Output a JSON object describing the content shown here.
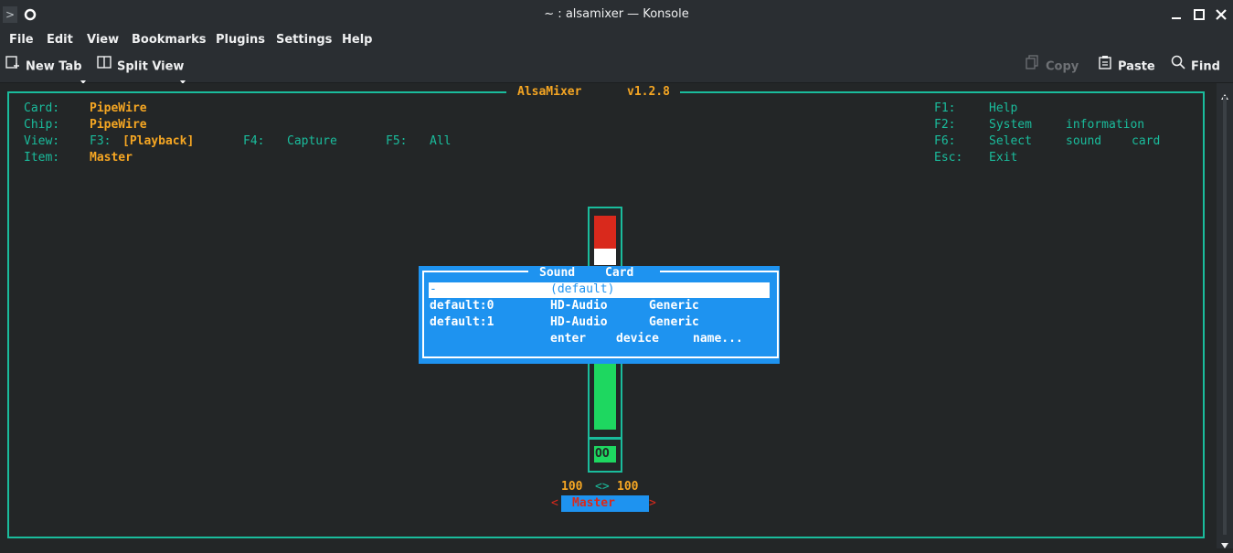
{
  "window": {
    "title": "~ : alsamixer — Konsole",
    "minimize_icon": "minimize-icon",
    "maximize_icon": "maximize-icon",
    "close_icon": "close-icon"
  },
  "menubar": {
    "items": [
      "File",
      "Edit",
      "View",
      "Bookmarks",
      "Plugins",
      "Settings",
      "Help"
    ]
  },
  "toolbar": {
    "new_tab": "New Tab",
    "split_view": "Split View",
    "copy": "Copy",
    "paste": "Paste",
    "find": "Find"
  },
  "mixer": {
    "app": "AlsaMixer",
    "version": "v1.2.8",
    "card_label": "Card:",
    "card_value": "PipeWire",
    "chip_label": "Chip:",
    "chip_value": "PipeWire",
    "view_label": "View:",
    "f3_key": "F3:",
    "f3_value": "[Playback]",
    "f4_key": "F4:",
    "f4_value": "Capture",
    "f5_key": "F5:",
    "f5_value": "All",
    "item_label": "Item:",
    "item_value": "Master",
    "help": [
      {
        "key": "F1:",
        "words": [
          "Help"
        ]
      },
      {
        "key": "F2:",
        "words": [
          "System",
          "information"
        ]
      },
      {
        "key": "F6:",
        "words": [
          "Select",
          "sound",
          "card"
        ]
      },
      {
        "key": "Esc:",
        "words": [
          "Exit"
        ]
      }
    ],
    "channel": {
      "mute_label": "OO",
      "left_level": "100",
      "arrows": "<>",
      "right_level": "100",
      "left_bracket": "<",
      "name": "Master",
      "right_bracket": ">"
    }
  },
  "dialog": {
    "title_words": [
      "Sound",
      "Card"
    ],
    "rows": [
      {
        "col1": "-",
        "col2": "(default)",
        "col3": "",
        "col4": ""
      },
      {
        "col1": "default:0",
        "col2": "HD-Audio",
        "col3": "Generic",
        "col4": ""
      },
      {
        "col1": "default:1",
        "col2": "HD-Audio",
        "col3": "Generic",
        "col4": ""
      },
      {
        "col1": "",
        "col2": "enter",
        "col3": "device",
        "col4": "name..."
      }
    ]
  },
  "colors": {
    "accent": "#1abc9c",
    "value": "#f5a623",
    "dialog_bg": "#1e93f0",
    "meter_red": "#d9291c",
    "meter_green": "#1ed760",
    "master_bg": "#1e93f0",
    "master_text": "#d9291c"
  }
}
